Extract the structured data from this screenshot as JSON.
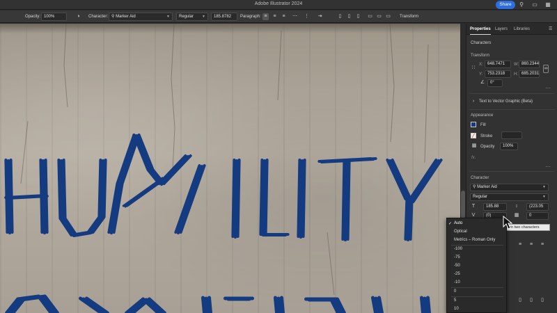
{
  "app": {
    "title": "Adobe Illustrator 2024",
    "share_label": "Share"
  },
  "titlebar_icons": [
    "search-icon",
    "window-icon",
    "grid-icon"
  ],
  "controlbar": {
    "opacity_label": "Opacity:",
    "opacity_value": "100%",
    "character_label": "Character:",
    "font_family": "Marker Aid",
    "font_style": "Regular",
    "font_size": "185.8782",
    "paragraph_label": "Paragraph:",
    "transform_label": "Transform"
  },
  "canvas": {
    "artwork_text_line1": "HUMILITY",
    "ink_color": "#143a80"
  },
  "panel": {
    "tabs": [
      "Properties",
      "Layers",
      "Libraries"
    ],
    "active_tab": "Properties",
    "selection_type": "Characters",
    "transform": {
      "heading": "Transform",
      "x_label": "X:",
      "x_value": "648.7471",
      "y_label": "Y:",
      "y_value": "753.2318",
      "w_label": "W:",
      "w_value": "860.2344",
      "h_label": "H:",
      "h_value": "685.2031",
      "rotate_value": "0°"
    },
    "text_to_vector": "Text to Vector Graphic (Beta)",
    "appearance": {
      "heading": "Appearance",
      "fill_label": "Fill",
      "stroke_label": "Stroke",
      "opacity_label": "Opacity",
      "opacity_value": "100%",
      "fx_label": "fx."
    },
    "character": {
      "heading": "Character",
      "font_family": "Marker Aid",
      "font_style": "Regular",
      "font_size": "185.88",
      "leading": "(223.05",
      "kerning": "(0)",
      "tracking": "0"
    }
  },
  "tooltip": {
    "text": "Set the Kerning between two characters"
  },
  "kerning_menu": {
    "selected": "Auto",
    "items": [
      "Auto",
      "Optical",
      "Metrics – Roman Only",
      "-100",
      "-75",
      "-50",
      "-25",
      "-10",
      "0",
      "5",
      "10"
    ]
  }
}
